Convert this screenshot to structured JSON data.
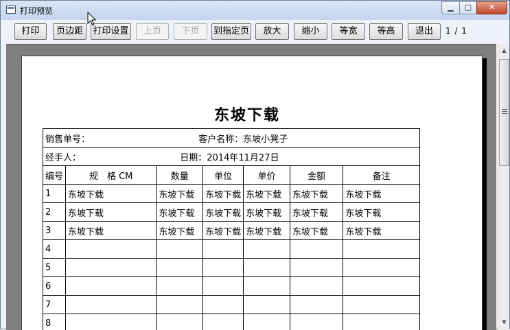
{
  "window": {
    "title": "打印预览",
    "minimize": "▁",
    "maximize": "□",
    "close": "✕"
  },
  "toolbar": {
    "buttons": [
      {
        "label": "打印",
        "enabled": true
      },
      {
        "label": "页边距",
        "enabled": true
      },
      {
        "label": "打印设置",
        "enabled": true
      },
      {
        "label": "上页",
        "enabled": false
      },
      {
        "label": "下页",
        "enabled": false
      },
      {
        "label": "到指定页",
        "enabled": true
      },
      {
        "label": "放大",
        "enabled": true
      },
      {
        "label": "缩小",
        "enabled": true
      },
      {
        "label": "等宽",
        "enabled": true
      },
      {
        "label": "等高",
        "enabled": true
      },
      {
        "label": "退出",
        "enabled": true
      }
    ],
    "page_indicator": "1 / 1"
  },
  "document": {
    "title": "东坡下载",
    "sales_no_label": "销售单号：",
    "customer_label": "客户名称：东坡小凳子",
    "handler_label": "经手人：",
    "date_label": "日期：2014年11月27日",
    "columns": [
      "编号",
      "规　格 CM",
      "数量",
      "单位",
      "单价",
      "金额",
      "备注"
    ],
    "rows": [
      [
        "1",
        "东坡下载",
        "东坡下载",
        "东坡下载",
        "东坡下载",
        "东坡下载",
        "东坡下载"
      ],
      [
        "2",
        "东坡下载",
        "东坡下载",
        "东坡下载",
        "东坡下载",
        "东坡下载",
        "东坡下载"
      ],
      [
        "3",
        "东坡下载",
        "东坡下载",
        "东坡下载",
        "东坡下载",
        "东坡下载",
        "东坡下载"
      ],
      [
        "4",
        "",
        "",
        "",
        "",
        "",
        ""
      ],
      [
        "5",
        "",
        "",
        "",
        "",
        "",
        ""
      ],
      [
        "6",
        "",
        "",
        "",
        "",
        "",
        ""
      ],
      [
        "7",
        "",
        "",
        "",
        "",
        "",
        ""
      ],
      [
        "8",
        "",
        "",
        "",
        "",
        "",
        ""
      ]
    ]
  },
  "scrollbar": {
    "up": "▲",
    "down": "▼"
  }
}
